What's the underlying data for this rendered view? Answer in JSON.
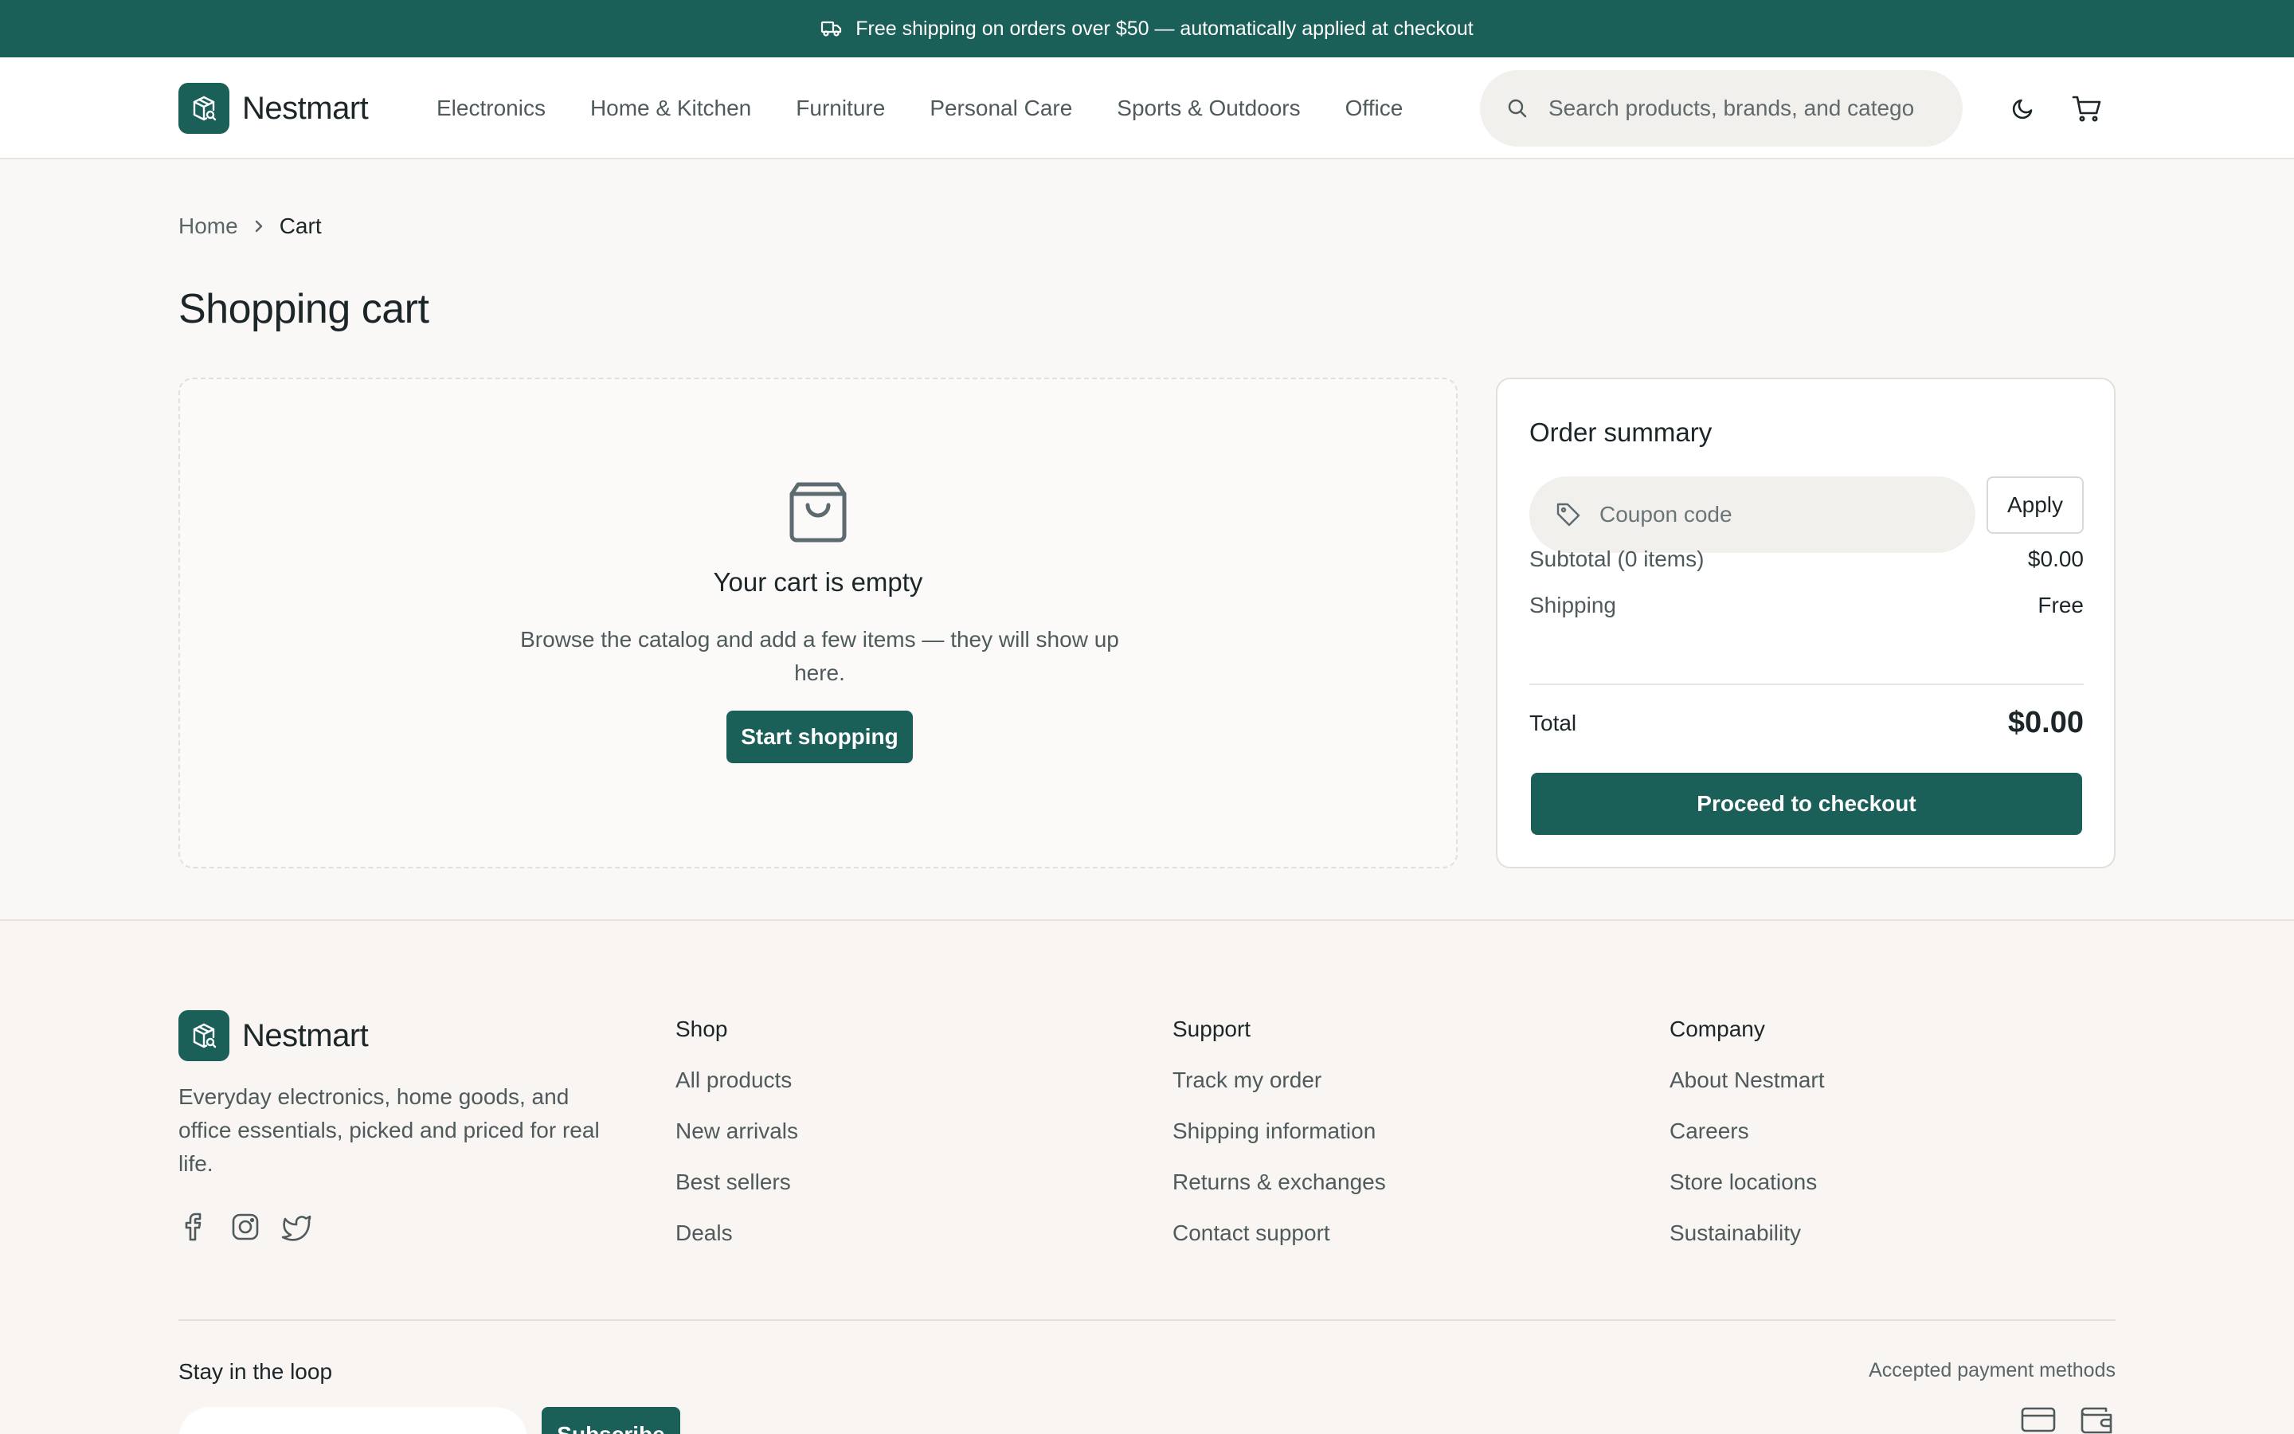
{
  "announcement": {
    "icon": "truck-icon",
    "text": "Free shipping on orders over $50 — automatically applied at checkout"
  },
  "header": {
    "logo_text": "Nestmart",
    "nav": [
      "Electronics",
      "Home & Kitchen",
      "Furniture",
      "Personal Care",
      "Sports & Outdoors",
      "Office"
    ],
    "search_placeholder": "Search products, brands, and categories",
    "theme_icon": "moon-icon",
    "cart_icon": "cart-icon"
  },
  "breadcrumb": {
    "home": "Home",
    "current": "Cart"
  },
  "page_title": "Shopping cart",
  "empty_cart": {
    "icon": "shopping-bag-icon",
    "title": "Your cart is empty",
    "description": "Browse the catalog and add a few items — they will show up here.",
    "button": "Start shopping"
  },
  "summary": {
    "title": "Order summary",
    "coupon_placeholder": "Coupon code",
    "apply": "Apply",
    "subtotal_label": "Subtotal (0 items)",
    "subtotal_value": "$0.00",
    "shipping_label": "Shipping",
    "shipping_value": "Free",
    "total_label": "Total",
    "total_value": "$0.00",
    "checkout": "Proceed to checkout"
  },
  "footer": {
    "logo_text": "Nestmart",
    "description": "Everyday electronics, home goods, and office essentials, picked and priced for real life.",
    "social_icons": [
      "facebook-icon",
      "instagram-icon",
      "twitter-icon"
    ],
    "columns": [
      {
        "title": "Shop",
        "links": [
          "All products",
          "New arrivals",
          "Best sellers",
          "Deals"
        ]
      },
      {
        "title": "Support",
        "links": [
          "Track my order",
          "Shipping information",
          "Returns & exchanges",
          "Contact support"
        ]
      },
      {
        "title": "Company",
        "links": [
          "About Nestmart",
          "Careers",
          "Store locations",
          "Sustainability"
        ]
      }
    ],
    "newsletter_title": "Stay in the loop",
    "subscribe": "Subscribe",
    "payment_label": "Accepted payment methods",
    "payment_icons": [
      "credit-card-icon",
      "wallet-icon"
    ]
  },
  "colors": {
    "brand": "#1a5f58",
    "background": "#faf8f6",
    "text": "#1c2628",
    "muted": "#4f5a5c"
  }
}
